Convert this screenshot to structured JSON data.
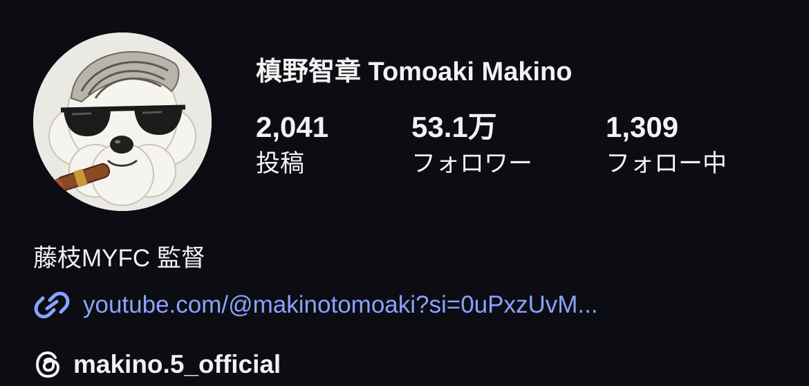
{
  "profile": {
    "avatar_icon": "poodle-avatar-icon",
    "display_name": "槙野智章 Tomoaki Makino",
    "stats": [
      {
        "count": "2,041",
        "label": "投稿"
      },
      {
        "count": "53.1万",
        "label": "フォロワー"
      },
      {
        "count": "1,309",
        "label": "フォロー中"
      }
    ],
    "bio": "藤枝MYFC 監督",
    "link": {
      "icon": "link-icon",
      "text": "youtube.com/@makinotomoaki?si=0uPxzUvM..."
    },
    "threads": {
      "icon": "threads-icon",
      "handle": "makino.5_official"
    }
  },
  "colors": {
    "background": "#0c0d13",
    "text": "#f2f2f2",
    "link": "#8ba2ff"
  }
}
